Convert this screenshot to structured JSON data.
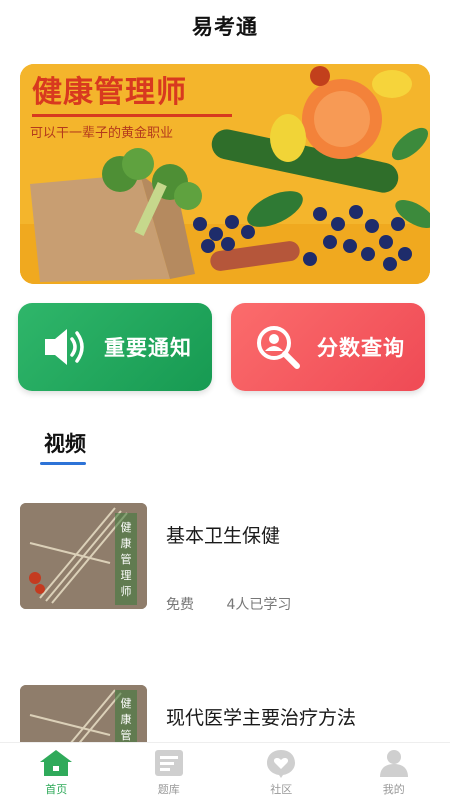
{
  "app": {
    "title": "易考通"
  },
  "banner": {
    "headline": "健康管理师",
    "subtitle": "可以干一辈子的黄金职业"
  },
  "actions": [
    {
      "label": "重要通知",
      "icon": "speaker-icon",
      "color": "#1fa95e"
    },
    {
      "label": "分数查询",
      "icon": "search-person-icon",
      "color": "#f45a5f"
    }
  ],
  "section": {
    "title": "视频"
  },
  "videos": [
    {
      "title": "基本卫生保健",
      "price": "免费",
      "learners": "4人已学习",
      "thumb_text": "健康管理师"
    },
    {
      "title": "现代医学主要治疗方法",
      "thumb_text": "健康管"
    }
  ],
  "tabbar": {
    "items": [
      {
        "label": "首页",
        "icon": "home-icon",
        "active": true
      },
      {
        "label": "题库",
        "icon": "question-bank-icon",
        "active": false
      },
      {
        "label": "社区",
        "icon": "community-icon",
        "active": false
      },
      {
        "label": "我的",
        "icon": "profile-icon",
        "active": false
      }
    ],
    "active_color": "#2faa5a",
    "inactive_color": "#cccccc"
  }
}
